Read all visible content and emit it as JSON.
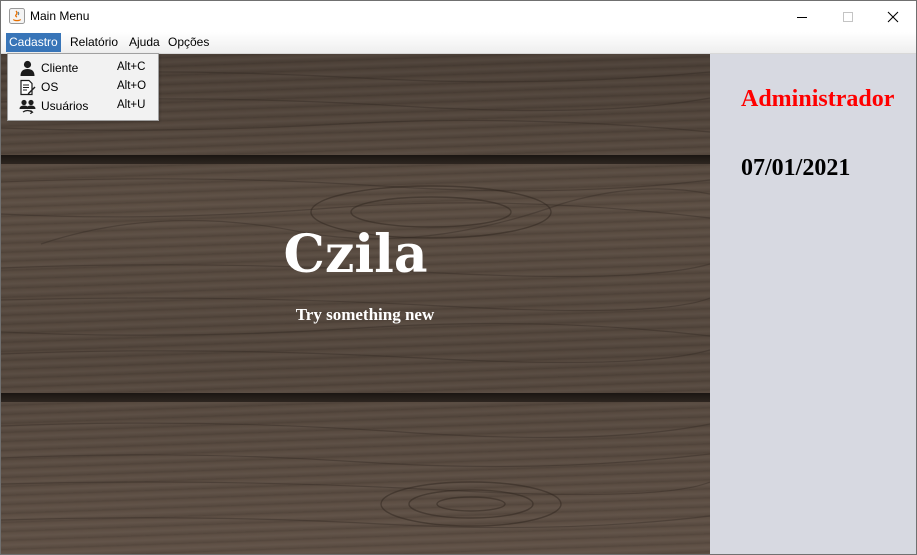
{
  "window": {
    "title": "Main Menu",
    "controls": {
      "minimize": "—",
      "maximize": "☐",
      "close": "✕"
    }
  },
  "menubar": {
    "items": [
      {
        "label": "Cadastro",
        "active": true
      },
      {
        "label": "Relatório",
        "active": false
      },
      {
        "label": "Ajuda",
        "active": false
      },
      {
        "label": "Opções",
        "active": false
      }
    ]
  },
  "dropdown": {
    "items": [
      {
        "label": "Cliente",
        "accelerator": "Alt+C",
        "icon": "user-icon"
      },
      {
        "label": "OS",
        "accelerator": "Alt+O",
        "icon": "document-edit-icon"
      },
      {
        "label": "Usuários",
        "accelerator": "Alt+U",
        "icon": "users-icon"
      }
    ]
  },
  "main": {
    "brand_title": "Czila",
    "brand_subtitle": "Try something new"
  },
  "side_panel": {
    "user": "Administrador",
    "date": "07/01/2021"
  },
  "colors": {
    "menu_active": "#3875b8",
    "user_label": "#ff0000",
    "side_panel_bg": "#d7d9e1"
  }
}
